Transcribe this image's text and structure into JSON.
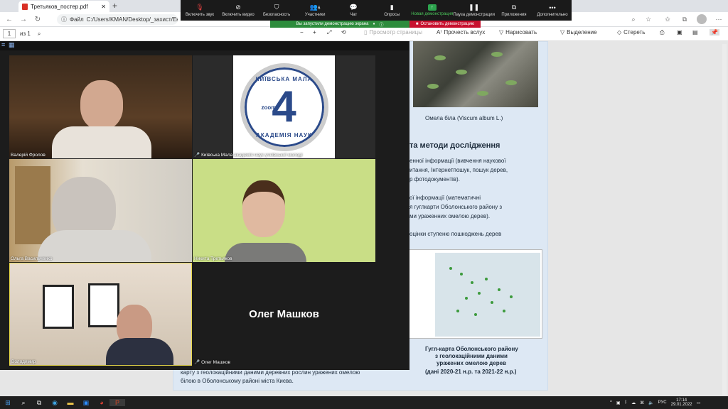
{
  "browser": {
    "tab_title": "Третьяков_постер.pdf",
    "new_tab": "+",
    "url_prefix": "Файл",
    "url": "C:/Users/KMAN/Desktop/_захист/Екологія/2022"
  },
  "pdf_toolbar": {
    "page_input": "1",
    "page_total": "из 1",
    "zoom_minus": "−",
    "zoom_plus": "+",
    "page_view": "Просмотр страницы",
    "read_aloud": "Прочесть вслух",
    "draw": "Нарисовать",
    "highlight": "Выделение",
    "erase": "Стереть"
  },
  "poster": {
    "caption_mistletoe": "Омела біла (Viscum album L.)",
    "section_title": "та методи дослідження",
    "line1": "енної інформації (вивчення наукової",
    "line2": "итання, Інтернетпошук, пошук дерев,",
    "line3": "р фотодокументів).",
    "line4": "ої інформації (математичні",
    "line5": "я гуглкарти Оболонського району з",
    "line6": "ми ураженних омелою дерев).",
    "line7": "оцінки ступеню  пошкоджень дерев",
    "map_caption1": "Гугл-карта Оболонського району",
    "map_caption2": "з геолокаційними даними",
    "map_caption3": "уражених омелою дерев",
    "map_caption4": "(дані 2020-21 н.р. та 2021-22 н.р.)",
    "bottom1": "карту з геолокаційними даними деревних рослин уражених омелою",
    "bottom2": "білою в Оболонському районі міста Києва."
  },
  "zoom_bar": {
    "items": [
      {
        "icon": "mic-muted-icon",
        "label": "Включить звук"
      },
      {
        "icon": "video-off-icon",
        "label": "Включить видео"
      },
      {
        "icon": "shield-icon",
        "label": "Безопасность"
      },
      {
        "icon": "participants-icon",
        "label": "Участники"
      },
      {
        "icon": "chat-icon",
        "label": "Чат"
      },
      {
        "icon": "polls-icon",
        "label": "Опросы"
      },
      {
        "icon": "share-icon",
        "label": "Новая демонстрация"
      },
      {
        "icon": "pause-icon",
        "label": "Пауза демонстрации"
      },
      {
        "icon": "apps-icon",
        "label": "Приложения"
      },
      {
        "icon": "more-icon",
        "label": "Дополнительно"
      }
    ],
    "participants_count": "6",
    "share_indicator": "Вы запустили демонстрацию экрана",
    "stop_share": "Остановить демонстрацию"
  },
  "gallery": {
    "tiles": [
      {
        "name": "Валерій Фролов",
        "muted": false
      },
      {
        "name": "Київська Мала академія наук учнівської молоді",
        "muted": true
      },
      {
        "name": "Ольга Васильченко",
        "muted": false
      },
      {
        "name": "Никита Третьяков",
        "muted": false
      },
      {
        "name": "Володимир",
        "muted": false
      },
      {
        "name": "Олег Машков",
        "muted": true
      }
    ],
    "oleg_big": "Олег Машков",
    "logo_top": "КИЇВСЬКА МАЛА",
    "logo_bottom": "АКАДЕМІЯ НАУК",
    "logo_num": "4",
    "logo_zoom": "zoom"
  },
  "taskbar": {
    "lang": "РУС",
    "time": "17:14",
    "date": "29.01.2022"
  }
}
